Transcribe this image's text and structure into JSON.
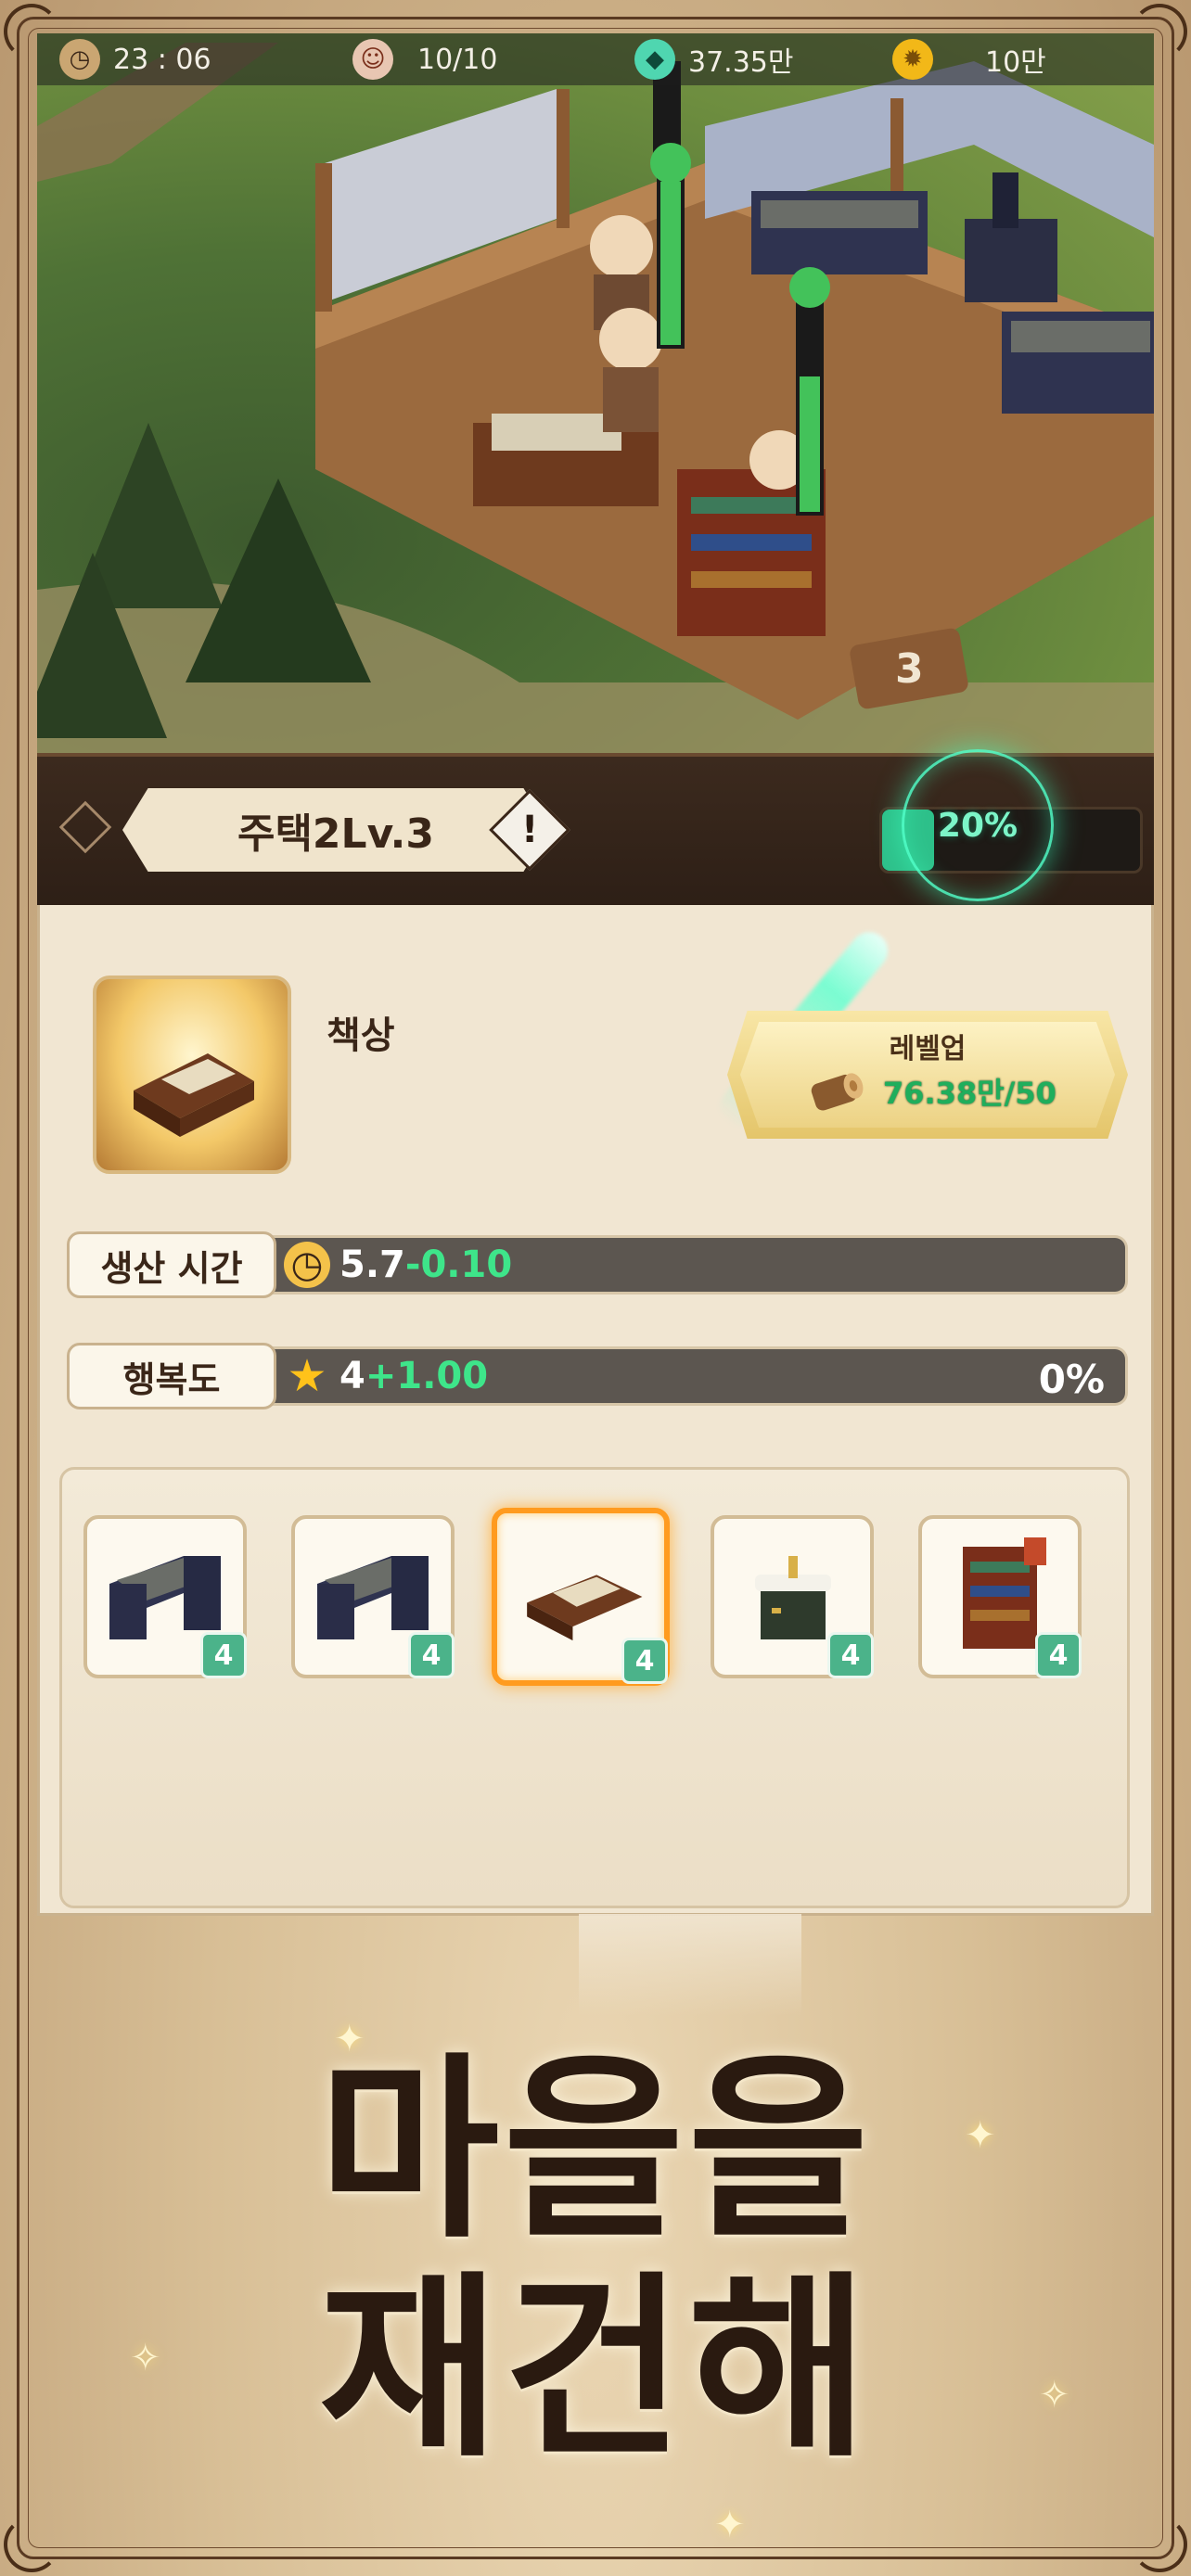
{
  "status_bar": {
    "clock": "23 : 06",
    "population": "10/10",
    "gems": "37.35만",
    "gold": "10만"
  },
  "building": {
    "title": "주택2Lv.3",
    "info_symbol": "!",
    "progress_text": "20%",
    "progress_value": 0.2
  },
  "item": {
    "name": "책상",
    "levelup_label": "레벨업",
    "levelup_cost": "76.38만/50"
  },
  "stats": {
    "production_time": {
      "label": "생산 시간",
      "base": "5.7",
      "bonus": "-0.10"
    },
    "happiness": {
      "label": "행복도",
      "base": "4",
      "bonus": "+1.00",
      "percent": "0%"
    }
  },
  "furniture": [
    {
      "icon": "bunk-bed-icon",
      "level": "4",
      "selected": false
    },
    {
      "icon": "bunk-bed-icon",
      "level": "4",
      "selected": false
    },
    {
      "icon": "desk-icon",
      "level": "4",
      "selected": true
    },
    {
      "icon": "sink-cabinet-icon",
      "level": "4",
      "selected": false
    },
    {
      "icon": "bookshelf-icon",
      "level": "4",
      "selected": false
    }
  ],
  "headline": {
    "line1": "마을을",
    "line2": "재건해"
  },
  "colors": {
    "accent_green": "#2ec08a",
    "bonus_green": "#3ee58a",
    "select_orange": "#ff9b1f",
    "panel_brown": "#2d1f16",
    "parchment": "#f1e6d2"
  }
}
